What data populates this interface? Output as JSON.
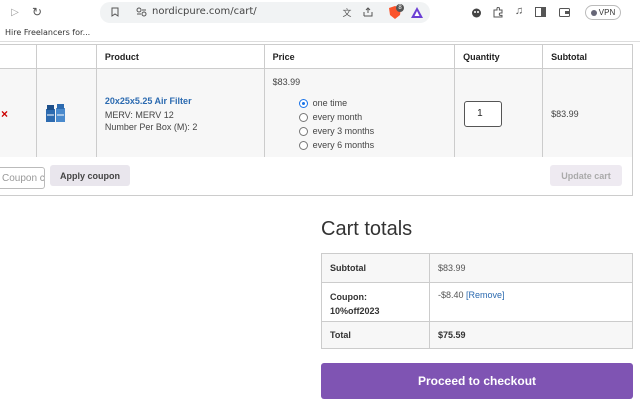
{
  "browser": {
    "url": "nordicpure.com/cart/",
    "bookmark": "Hire Freelancers for...",
    "vpn_label": "VPN",
    "shield_count": "8"
  },
  "cart": {
    "headers": {
      "product": "Product",
      "price": "Price",
      "quantity": "Quantity",
      "subtotal": "Subtotal"
    },
    "item": {
      "remove": "×",
      "name": "20x25x5.25 Air Filter",
      "merv": "MERV: MERV 12",
      "per_box": "Number Per Box (M): 2",
      "price": "$83.99",
      "quantity": "1",
      "subtotal": "$83.99",
      "frequency_options": [
        "one time",
        "every month",
        "every 3 months",
        "every 6 months"
      ],
      "frequency_selected": "one time"
    },
    "coupon_placeholder": "Coupon code",
    "apply_coupon": "Apply coupon",
    "update_cart": "Update cart"
  },
  "totals": {
    "title": "Cart totals",
    "subtotal_label": "Subtotal",
    "subtotal_value": "$83.99",
    "coupon_label_1": "Coupon:",
    "coupon_label_2": "10%off2023",
    "coupon_value": "-$8.40",
    "coupon_remove": "[Remove]",
    "total_label": "Total",
    "total_value": "$75.59",
    "checkout": "Proceed to checkout"
  },
  "colors": {
    "accent": "#7f54b3",
    "link": "#2b6ab0",
    "remove": "#cc0000"
  }
}
